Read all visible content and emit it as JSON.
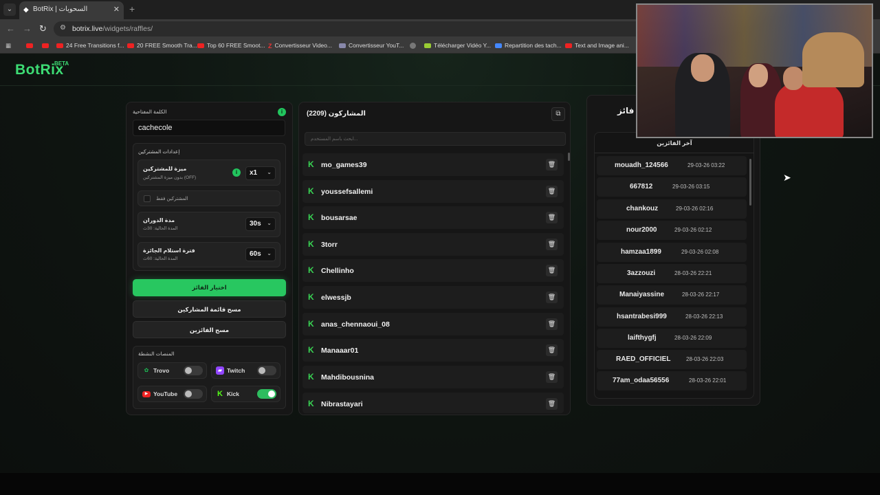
{
  "browser": {
    "tab_title": "BotRix | السحوبات",
    "url_host": "botrix.live",
    "url_path": "/widgets/raffles/",
    "bookmarks": [
      {
        "label": "",
        "icon": "youtube-icon"
      },
      {
        "label": "",
        "icon": "youtube-icon"
      },
      {
        "label": "24 Free Transitions f...",
        "icon": "youtube-icon"
      },
      {
        "label": "20 FREE Smooth Tra...",
        "icon": "youtube-icon"
      },
      {
        "label": "Top 60 FREE Smoot...",
        "icon": "youtube-icon"
      },
      {
        "label": "Convertisseur Video...",
        "icon": "z-icon"
      },
      {
        "label": "Convertisseur YouT...",
        "icon": "converter-icon"
      },
      {
        "label": "",
        "icon": "globe-icon"
      },
      {
        "label": "Télécharger Vidéo Y...",
        "icon": "download-icon"
      },
      {
        "label": "Repartition des tach...",
        "icon": "docs-icon"
      },
      {
        "label": "Text and Image ani...",
        "icon": "youtube-icon"
      }
    ]
  },
  "site": {
    "logo": "BotRix",
    "beta": "BETA"
  },
  "settings": {
    "keyword_label": "الكلمة المفتاحية",
    "keyword_value": "cachecole",
    "participants_settings_label": "إعدادات المشتركين",
    "sub_bonus_title": "ميزة للمشتركين",
    "sub_bonus_sub": "بدون ميزة المشتركين (OFF)",
    "sub_bonus_value": "x1",
    "subs_only_label": "المشتركين فقط",
    "spin_title": "مدة الدوران",
    "spin_sub": "المدة الحالية: 30ث",
    "spin_value": "30s",
    "claim_title": "فترة استلام الجائزة",
    "claim_sub": "المدة الحالية: 60ث",
    "claim_value": "60s",
    "pick_winner": "اختيار الفائز",
    "clear_participants": "مسح قائمة المشاركين",
    "clear_winners": "مسح الفائزين",
    "platforms_label": "المنصات النشطة",
    "platforms": [
      {
        "name": "Trovo",
        "on": false,
        "color": "#1db954"
      },
      {
        "name": "Twitch",
        "on": false,
        "color": "#9146ff"
      },
      {
        "name": "YouTube",
        "on": false,
        "color": "#e22"
      },
      {
        "name": "Kick",
        "on": true,
        "color": "#53fc18"
      }
    ]
  },
  "participants": {
    "title": "المشاركون (2209)",
    "search_placeholder": "ابحث باسم المستخدم...",
    "list": [
      "mo_games39",
      "youssefsallemi",
      "bousarsae",
      "3torr",
      "Chellinho",
      "elwessjb",
      "anas_chennaoui_08",
      "Manaaar01",
      "Mahdibousnina",
      "Nibrastayari"
    ]
  },
  "winners": {
    "title": "فائز",
    "subtitle": "آخر الفائزين",
    "list": [
      {
        "name": "mouadh_124566",
        "date": "29-03-26 03:22"
      },
      {
        "name": "667812",
        "date": "29-03-26 03:15"
      },
      {
        "name": "chankouz",
        "date": "29-03-26 02:16"
      },
      {
        "name": "nour2000",
        "date": "29-03-26 02:12"
      },
      {
        "name": "hamzaa1899",
        "date": "29-03-26 02:08"
      },
      {
        "name": "3azzouzi",
        "date": "28-03-26 22:21"
      },
      {
        "name": "Manaiyassine",
        "date": "28-03-26 22:17"
      },
      {
        "name": "hsantrabesi999",
        "date": "28-03-26 22:13"
      },
      {
        "name": "laifthygfj",
        "date": "28-03-26 22:09"
      },
      {
        "name": "RAED_OFFICIEL",
        "date": "28-03-26 22:03"
      },
      {
        "name": "77am_odaa56556",
        "date": "28-03-26 22:01"
      }
    ]
  }
}
